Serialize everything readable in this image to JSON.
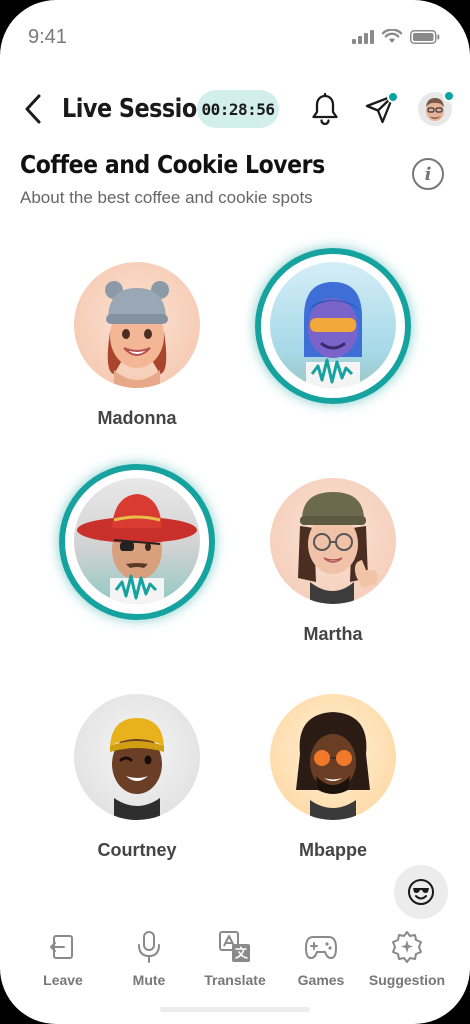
{
  "status_bar": {
    "time": "9:41"
  },
  "header": {
    "title": "Live Session",
    "timer": "00:28:56"
  },
  "room": {
    "title": "Coffee and Cookie Lovers",
    "subtitle": "About the best coffee and cookie spots",
    "info_glyph": "i"
  },
  "colors": {
    "accent": "#16a39f",
    "timer_bg": "#d2efec",
    "text_dark": "#1a1a1a",
    "text_muted": "#777777"
  },
  "participants": [
    {
      "name": "Madonna",
      "speaking": false,
      "bg": "#f7d2bf"
    },
    {
      "name": "",
      "speaking": true,
      "bg": "#bfe6f0"
    },
    {
      "name": "",
      "speaking": true,
      "bg": "#d8d8d8"
    },
    {
      "name": "Martha",
      "speaking": false,
      "bg": "#f7d5c4"
    },
    {
      "name": "Courtney",
      "speaking": false,
      "bg": "#e2e2e2"
    },
    {
      "name": "Mbappe",
      "speaking": false,
      "bg": "#fde0b4"
    }
  ],
  "tabs": [
    {
      "label": "Leave",
      "icon": "leave-icon"
    },
    {
      "label": "Mute",
      "icon": "microphone-icon"
    },
    {
      "label": "Translate",
      "icon": "translate-icon"
    },
    {
      "label": "Games",
      "icon": "gamepad-icon"
    },
    {
      "label": "Suggestion",
      "icon": "sparkle-icon"
    }
  ],
  "icons": {
    "back": "chevron-left-icon",
    "notifications": "bell-icon",
    "share": "send-icon",
    "info": "info-icon",
    "reaction": "smiling-sunglasses-icon"
  }
}
